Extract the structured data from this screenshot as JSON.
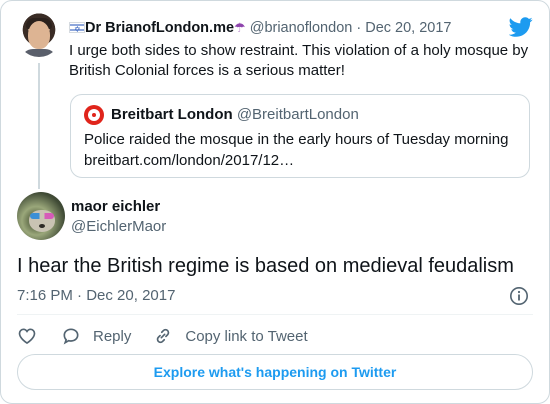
{
  "parent_tweet": {
    "display_name": "Dr BrianofLondon.me",
    "handle": "@brianoflondon",
    "separator": "·",
    "date": "Dec 20, 2017",
    "text": "I urge both sides to show restraint. This violation of a holy mosque by British Colonial forces is a serious matter!",
    "flag_icon": "israel-flag-icon",
    "emoji_icon": "umbrella-icon"
  },
  "quoted_tweet": {
    "display_name": "Breitbart London",
    "handle": "@BreitbartLondon",
    "text": "Police raided the mosque in the early hours of Tuesday morning",
    "link": "breitbart.com/london/2017/12…"
  },
  "main_tweet": {
    "display_name": "maor eichler",
    "handle": "@EichlerMaor",
    "text": "I hear the British regime is based on medieval feudalism",
    "time": "7:16 PM",
    "separator": "·",
    "date": "Dec 20, 2017"
  },
  "actions": {
    "like_icon": "heart-icon",
    "reply_label": "Reply",
    "copy_link_label": "Copy link to Tweet"
  },
  "footer": {
    "explore_label": "Explore what's happening on Twitter"
  },
  "colors": {
    "accent": "#1d9bf0",
    "text": "#0f1419",
    "secondary": "#536471",
    "border": "#cfd9de"
  }
}
